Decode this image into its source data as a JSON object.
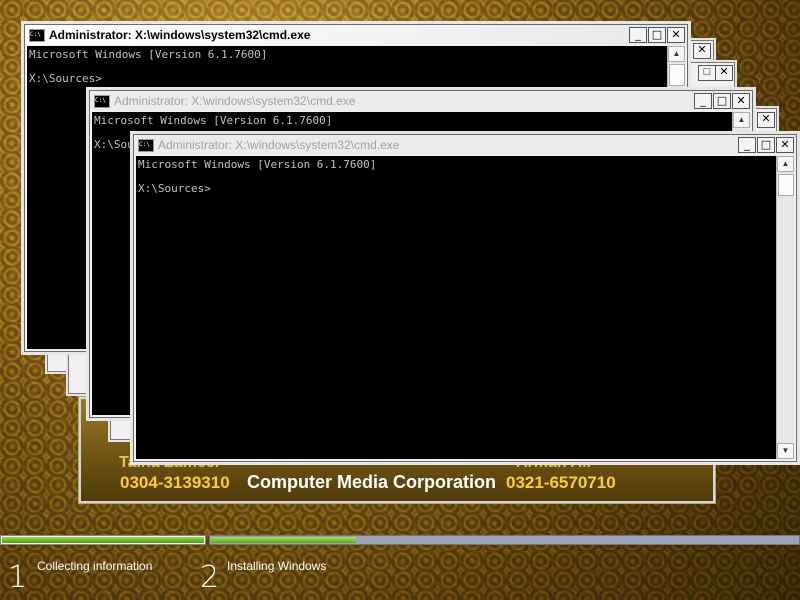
{
  "windows": [
    {
      "title": "Administrator: X:\\windows\\system32\\cmd.exe",
      "lines": "Microsoft Windows [Version 6.1.7600]\n\nX:\\Sources>"
    },
    {
      "title": "Administrator: X:\\windows\\system32\\cmd.exe",
      "lines": "Microsoft Windows [Version 6.1.7600]\n\nX:\\Sources>"
    },
    {
      "title": "Administrator: X:\\windows\\system32\\cmd.exe",
      "lines": "Microsoft Windows [Version 6.1.7600]\n\nX:\\Sources>"
    }
  ],
  "icon_text": "C:\\",
  "controls": {
    "minimize": "_",
    "maximize": "□",
    "close": "✕"
  },
  "scroll": {
    "up": "▲",
    "down": "▼"
  },
  "setup_panel": {
    "contact_left_name": "Talha Zameer",
    "contact_left_phone": "0304-3139310",
    "company": "Computer Media Corporation",
    "contact_right_name": "Arman Ali",
    "contact_right_phone": "0321-6570710"
  },
  "progress": {
    "steps": [
      {
        "number": "1",
        "label": "Collecting information",
        "completion": 1.0
      },
      {
        "number": "2",
        "label": "Installing Windows",
        "completion": 0.25
      }
    ]
  },
  "colors": {
    "progress_green": "#4f9b1a",
    "console_bg": "#000000",
    "console_text": "#c0c0c0"
  }
}
